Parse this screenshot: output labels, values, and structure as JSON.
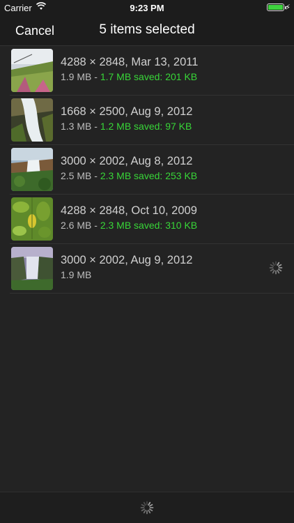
{
  "status": {
    "carrier": "Carrier",
    "time": "9:23 PM",
    "battery_level": 1.0
  },
  "nav": {
    "cancel_label": "Cancel",
    "title": "5 items selected"
  },
  "items": [
    {
      "dims": "4288 × 2848, Mar 13, 2011",
      "size": "1.9 MB",
      "separator": " - ",
      "saved": "1.7 MB saved: 201 KB",
      "processing": false
    },
    {
      "dims": "1668 × 2500, Aug 9, 2012",
      "size": "1.3 MB",
      "separator": " - ",
      "saved": "1.2 MB saved: 97 KB",
      "processing": false
    },
    {
      "dims": "3000 × 2002, Aug 8, 2012",
      "size": "2.5 MB",
      "separator": " - ",
      "saved": "2.3 MB saved: 253 KB",
      "processing": false
    },
    {
      "dims": "4288 × 2848, Oct 10, 2009",
      "size": "2.6 MB",
      "separator": " - ",
      "saved": "2.3 MB saved: 310 KB",
      "processing": false
    },
    {
      "dims": "3000 × 2002, Aug 9, 2012",
      "size": "1.9 MB",
      "separator": "",
      "saved": "",
      "processing": true
    }
  ],
  "colors": {
    "saved_green": "#38d638",
    "background": "#232323"
  }
}
